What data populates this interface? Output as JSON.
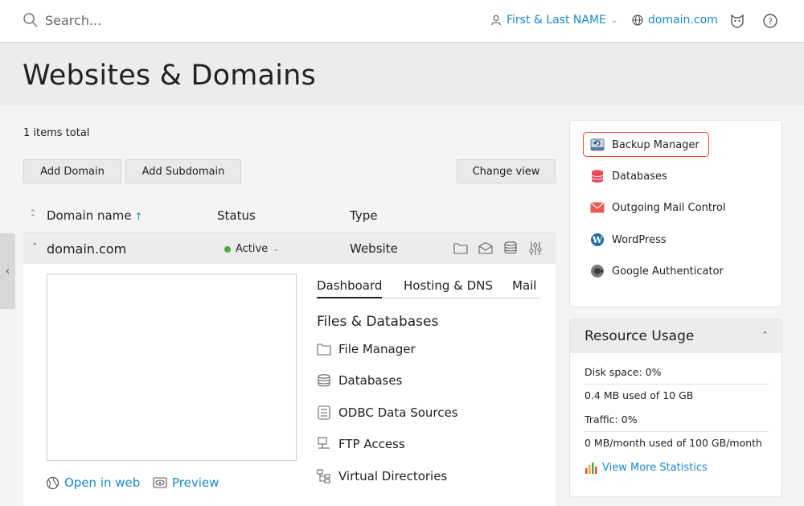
{
  "topbar": {
    "search_placeholder": "Search...",
    "user_name": "First & Last NAME",
    "domain": "domain.com",
    "icons": [
      "search-icon",
      "user-icon",
      "chevron-down-icon",
      "globe-icon",
      "cat-icon",
      "help-icon"
    ]
  },
  "page": {
    "title": "Websites & Domains",
    "items_total": "1 items total"
  },
  "toolbar": {
    "add_domain": "Add Domain",
    "add_subdomain": "Add Subdomain",
    "change_view": "Change view"
  },
  "table": {
    "headers": {
      "domain_name": "Domain name",
      "status": "Status",
      "type": "Type"
    },
    "row": {
      "domain": "domain.com",
      "status": "Active",
      "type": "Website"
    }
  },
  "details": {
    "open_in_web": "Open in web",
    "preview": "Preview",
    "tabs": [
      "Dashboard",
      "Hosting & DNS",
      "Mail"
    ],
    "active_tab": "Dashboard",
    "section_title": "Files & Databases",
    "tools": [
      "File Manager",
      "Databases",
      "ODBC Data Sources",
      "FTP Access",
      "Virtual Directories"
    ]
  },
  "sidebar": {
    "items": [
      "Backup Manager",
      "Databases",
      "Outgoing Mail Control",
      "WordPress",
      "Google Authenticator"
    ],
    "highlighted": "Backup Manager"
  },
  "resource_usage": {
    "title": "Resource Usage",
    "disk_space": "Disk space: 0%",
    "disk_detail": "0.4 MB used of 10 GB",
    "traffic": "Traffic: 0%",
    "traffic_detail": "0 MB/month used of 100 GB/month",
    "view_more": "View More Statistics"
  },
  "colors": {
    "link": "#1a88c9",
    "active_status": "#4ba93c",
    "highlight_border": "#e0472d"
  }
}
